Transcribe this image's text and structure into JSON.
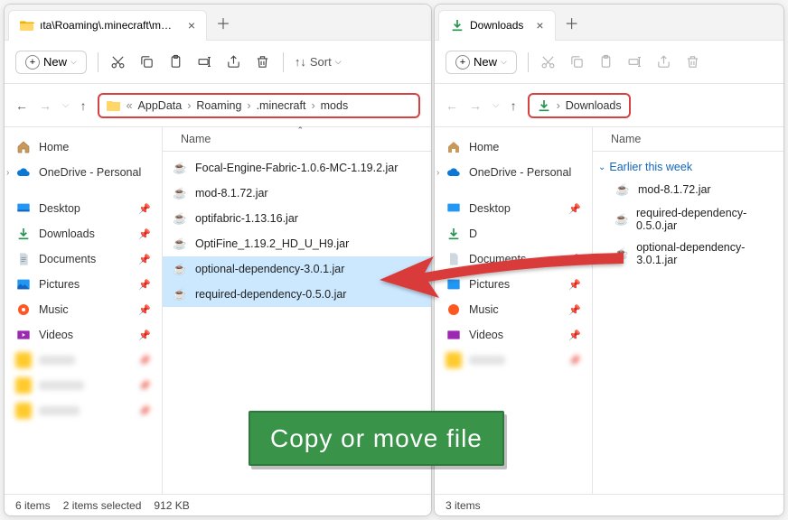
{
  "left": {
    "tab_title": "ıta\\Roaming\\.minecraft\\mods",
    "new_label": "New",
    "sort_label": "Sort",
    "breadcrumb": [
      "AppData",
      "Roaming",
      ".minecraft",
      "mods"
    ],
    "breadcrumb_prefix": "«",
    "sidebar": {
      "home": "Home",
      "onedrive": "OneDrive - Personal",
      "desktop": "Desktop",
      "downloads": "Downloads",
      "documents": "Documents",
      "pictures": "Pictures",
      "music": "Music",
      "videos": "Videos"
    },
    "col_name": "Name",
    "files": [
      "Focal-Engine-Fabric-1.0.6-MC-1.19.2.jar",
      "mod-8.1.72.jar",
      "optifabric-1.13.16.jar",
      "OptiFine_1.19.2_HD_U_H9.jar",
      "optional-dependency-3.0.1.jar",
      "required-dependency-0.5.0.jar"
    ],
    "selected": [
      4,
      5
    ],
    "status_items": "6 items",
    "status_selected": "2 items selected",
    "status_size": "912 KB"
  },
  "right": {
    "tab_title": "Downloads",
    "new_label": "New",
    "breadcrumb": [
      "Downloads"
    ],
    "sidebar": {
      "home": "Home",
      "onedrive": "OneDrive - Personal",
      "desktop": "Desktop",
      "downloads_partial": "D",
      "documents": "Documents",
      "pictures": "Pictures",
      "music": "Music",
      "videos": "Videos"
    },
    "col_name": "Name",
    "group_label": "Earlier this week",
    "files": [
      "mod-8.1.72.jar",
      "required-dependency-0.5.0.jar",
      "optional-dependency-3.0.1.jar"
    ],
    "status_items": "3 items"
  },
  "banner_text": "Copy or move file"
}
